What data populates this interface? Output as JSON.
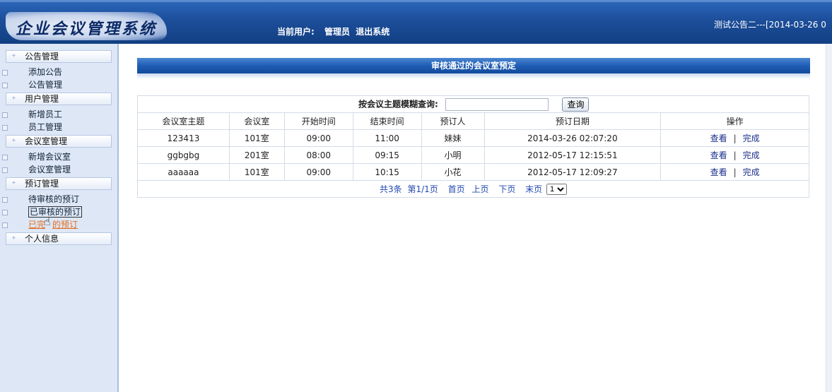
{
  "header": {
    "logo_text": "企业会议管理系统",
    "current_user_label": "当前用户:",
    "user_name": "管理员",
    "logout_label": "退出系统",
    "notice": "测试公告二---[2014-03-26 0"
  },
  "sidebar": {
    "groups": [
      {
        "label": "公告管理",
        "items": [
          "添加公告",
          "公告管理"
        ]
      },
      {
        "label": "用户管理",
        "items": [
          "新增员工",
          "员工管理"
        ]
      },
      {
        "label": "会议室管理",
        "items": [
          "新增会议室",
          "会议室管理"
        ]
      },
      {
        "label": "预订管理",
        "items": [
          "待审核的预订",
          "已审核的预订",
          "已完成的预订"
        ]
      },
      {
        "label": "个人信息",
        "items": []
      }
    ],
    "active_item_visible": "已完",
    "active_item_visible_tail": "的预订"
  },
  "main": {
    "title": "审核通过的会议室预定",
    "search": {
      "label": "按会议主题模糊查询:",
      "value": "",
      "button": "查询"
    },
    "columns": [
      "会议室主题",
      "会议室",
      "开始时间",
      "结束时间",
      "预订人",
      "预订日期",
      "操作"
    ],
    "rows": [
      {
        "subject": "123413",
        "room": "101室",
        "start": "09:00",
        "end": "11:00",
        "booker": "妹妹",
        "date": "2014-03-26 02:07:20"
      },
      {
        "subject": "ggbgbg",
        "room": "201室",
        "start": "08:00",
        "end": "09:15",
        "booker": "小明",
        "date": "2012-05-17 12:15:51"
      },
      {
        "subject": "aaaaaa",
        "room": "101室",
        "start": "09:00",
        "end": "10:15",
        "booker": "小花",
        "date": "2012-05-17 12:09:27"
      }
    ],
    "actions": {
      "view": "查看",
      "separator": "|",
      "complete": "完成"
    },
    "pager": {
      "total": "共3条",
      "page": "第1/1页",
      "first": "首页",
      "prev": "上页",
      "next": "下页",
      "last": "末页",
      "selected_page": "1"
    }
  }
}
